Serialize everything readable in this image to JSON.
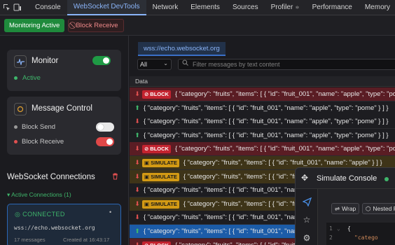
{
  "devtools": {
    "tabs": [
      {
        "label": "Console"
      },
      {
        "label": "WebSocket DevTools"
      },
      {
        "label": "Network"
      },
      {
        "label": "Elements"
      },
      {
        "label": "Sources"
      },
      {
        "label": "Profiler"
      },
      {
        "label": "Performance"
      },
      {
        "label": "Memory"
      }
    ],
    "active_tab": "WebSocket DevTools"
  },
  "toolbar": {
    "monitoring_label": "Monitoring Active",
    "block_receive_label": "Block Receive"
  },
  "sidebar": {
    "monitor": {
      "title": "Monitor",
      "status": "Active",
      "enabled": true
    },
    "message_control": {
      "title": "Message Control",
      "block_send_label": "Block Send",
      "block_send_enabled": false,
      "block_receive_label": "Block Receive",
      "block_receive_enabled": true
    },
    "connections": {
      "title": "WebSocket Connections",
      "active_label": "Active Connections (1)",
      "items": [
        {
          "status": "CONNECTED",
          "url": "wss://echo.websocket.org",
          "messages": "17 messages",
          "created": "Created at 16:43:17"
        }
      ]
    }
  },
  "main": {
    "connection_tab": "wss://echo.websocket.org",
    "filter_select": "All",
    "search_placeholder": "Filter messages by text content",
    "data_header": "Data",
    "messages": [
      {
        "dir": "down",
        "badge": "BLOCK",
        "kind": "block",
        "text": "{ \"category\": \"fruits\", \"items\": [ { \"id\": \"fruit_001\", \"name\": \"apple\", \"type\": \"pome\" } ] }"
      },
      {
        "dir": "up",
        "badge": "",
        "kind": "normal",
        "text": "{ \"category\": \"fruits\", \"items\": [ { \"id\": \"fruit_001\", \"name\": \"apple\", \"type\": \"pome\" } ] }"
      },
      {
        "dir": "down",
        "badge": "",
        "kind": "normal",
        "text": "{ \"category\": \"fruits\", \"items\": [ { \"id\": \"fruit_001\", \"name\": \"apple\", \"type\": \"pome\" } ] }"
      },
      {
        "dir": "up",
        "badge": "",
        "kind": "normal",
        "text": "{ \"category\": \"fruits\", \"items\": [ { \"id\": \"fruit_001\", \"name\": \"apple\", \"type\": \"pome\" } ] }"
      },
      {
        "dir": "down",
        "badge": "BLOCK",
        "kind": "block",
        "text": "{ \"category\": \"fruits\", \"items\": [ { \"id\": \"fruit_001\", \"name\": \"apple\", \"type\": \"pome\" } ] }"
      },
      {
        "dir": "down",
        "badge": "SIMULATE",
        "kind": "simulate",
        "text": "{ \"category\": \"fruits\", \"items\": [ { \"id\": \"fruit_001\", \"name\": \"apple\" } ] }"
      },
      {
        "dir": "down",
        "badge": "SIMULATE",
        "kind": "simulate",
        "text": "{ \"category\": \"fruits\", \"items\": [ { \"id\": \"fruit_001\", \"name\": \"apple\" } ] }"
      },
      {
        "dir": "down",
        "badge": "",
        "kind": "normal",
        "text": "{ \"category\": \"fruits\", \"items\": [ { \"id\": \"fruit_001\", \"name\": \"apple\" } ] }"
      },
      {
        "dir": "down",
        "badge": "SIMULATE",
        "kind": "simulate",
        "text": "{ \"category\": \"fruits\", \"items\": [ { \"id\": \"fruit_001\", \"name\": \"apple\" } ] }"
      },
      {
        "dir": "down",
        "badge": "",
        "kind": "normal",
        "text": "{ \"category\": \"fruits\", \"items\": [ { \"id\": \"fruit_001\", \"name\": \"apple\" } ] }"
      },
      {
        "dir": "up",
        "badge": "",
        "kind": "selected",
        "text": "{ \"category\": \"fruits\", \"items\": [ { \"id\": \"fruit_001\", \"name\": \"apple\" } ] }"
      },
      {
        "dir": "down",
        "badge": "BLOCK",
        "kind": "block",
        "text": "{ \"category\": \"fruits\", \"items\": [ { \"id\": \"fruit_001\", \"name\": \"apple\" } ] }"
      }
    ]
  },
  "simulate_console": {
    "title": "Simulate Console",
    "wrap_label": "Wrap",
    "nested_label": "Nested P",
    "code_lines": [
      {
        "num": "1",
        "text": "{"
      },
      {
        "num": "2",
        "text": "\"catego"
      }
    ]
  },
  "colors": {
    "accent": "#8ab4f8",
    "green": "#3fb66b",
    "red": "#e05050",
    "block_row": "#5a1d24",
    "simulate_row": "#3e3418",
    "selected_row": "#1c5ca8"
  }
}
